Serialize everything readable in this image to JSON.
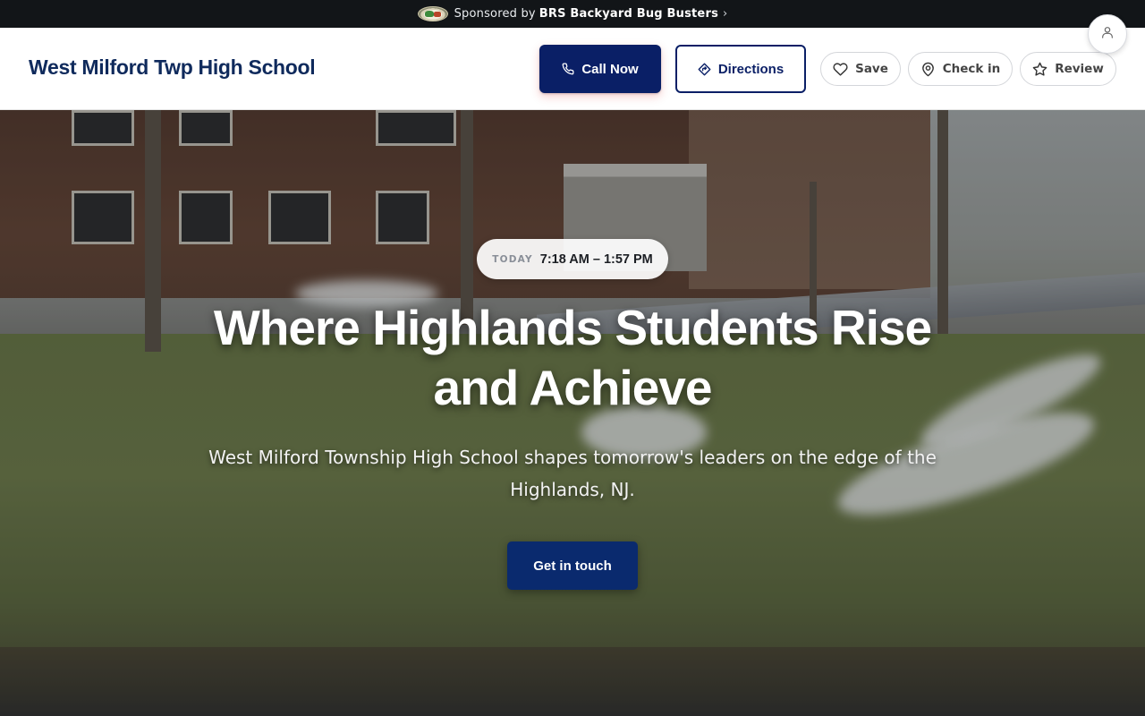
{
  "sponsor": {
    "prefix": "Sponsored by",
    "name": "BRS Backyard Bug Busters",
    "chevron": "›",
    "logo_icon": "sponsor-logo"
  },
  "header": {
    "title": "West Milford Twp High School",
    "call_label": "Call Now",
    "directions_label": "Directions",
    "save_label": "Save",
    "checkin_label": "Check in",
    "review_label": "Review",
    "account_icon": "user-icon"
  },
  "hero": {
    "hours_label": "TODAY",
    "hours_value": "7:18 AM – 1:57 PM",
    "title": "Where Highlands Students Rise and Achieve",
    "subtitle": "West Milford Township High School shapes tomorrow's leaders on the edge of the Highlands, NJ.",
    "cta_label": "Get in touch"
  },
  "colors": {
    "primary": "#0a1f66",
    "sponsor_bar": "#121518",
    "title": "#0f2a5c"
  }
}
